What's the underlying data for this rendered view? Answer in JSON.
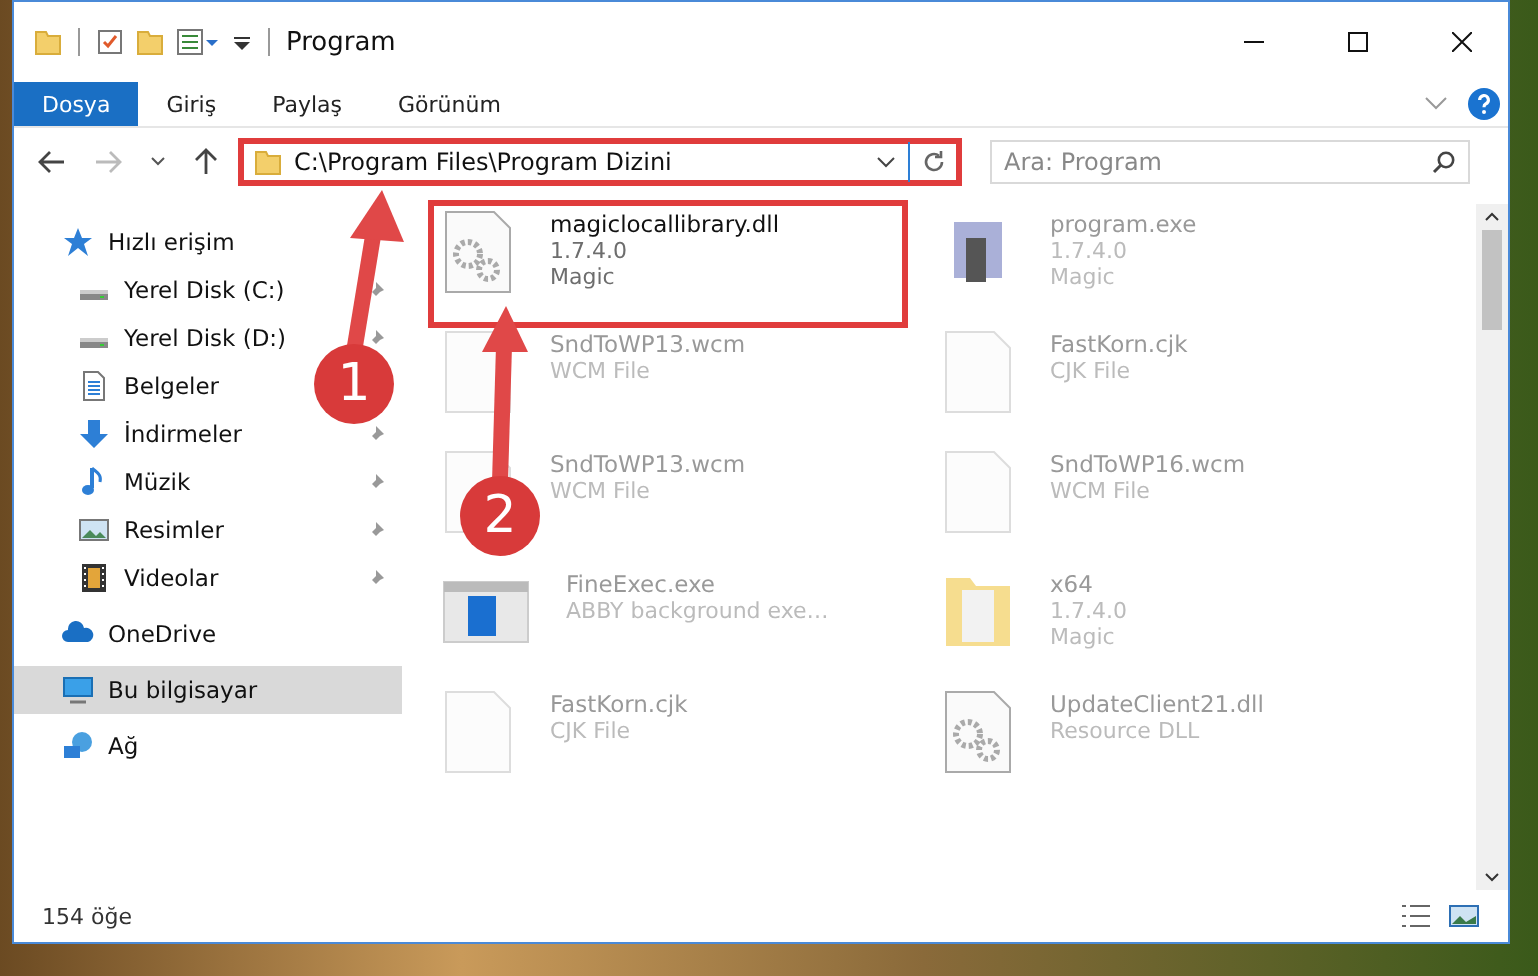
{
  "window": {
    "title": "Program"
  },
  "ribbon_tabs": [
    {
      "label": "Dosya",
      "selected": true
    },
    {
      "label": "Giriş",
      "selected": false
    },
    {
      "label": "Paylaş",
      "selected": false
    },
    {
      "label": "Görünüm",
      "selected": false
    }
  ],
  "address": {
    "path": "C:\\Program Files\\Program Dizini",
    "highlighted": true
  },
  "search": {
    "placeholder": "Ara: Program"
  },
  "sidebar": {
    "items": [
      {
        "label": "Hızlı erişim",
        "kind": "star",
        "pinned": false,
        "selected": false,
        "group": true
      },
      {
        "label": "Yerel Disk (C:)",
        "kind": "drive",
        "pinned": true,
        "selected": false,
        "group": false
      },
      {
        "label": "Yerel Disk (D:)",
        "kind": "drive",
        "pinned": true,
        "selected": false,
        "group": false
      },
      {
        "label": "Belgeler",
        "kind": "document",
        "pinned": false,
        "selected": false,
        "group": false
      },
      {
        "label": "İndirmeler",
        "kind": "download",
        "pinned": true,
        "selected": false,
        "group": false
      },
      {
        "label": "Müzik",
        "kind": "music",
        "pinned": true,
        "selected": false,
        "group": false
      },
      {
        "label": "Resimler",
        "kind": "picture",
        "pinned": true,
        "selected": false,
        "group": false
      },
      {
        "label": "Videolar",
        "kind": "video",
        "pinned": true,
        "selected": false,
        "group": false
      },
      {
        "label": "OneDrive",
        "kind": "cloud",
        "pinned": false,
        "selected": false,
        "group": true
      },
      {
        "label": "Bu bilgisayar",
        "kind": "computer",
        "pinned": false,
        "selected": true,
        "group": true
      },
      {
        "label": "Ağ",
        "kind": "network",
        "pinned": false,
        "selected": false,
        "group": true
      }
    ]
  },
  "files": [
    {
      "name": "magiclocallibrary.dll",
      "details": [
        "1.7.4.0",
        "Magic"
      ],
      "kind": "gears",
      "highlighted": true
    },
    {
      "name": "program.exe",
      "details": [
        "1.7.4.0",
        "Magic"
      ],
      "kind": "app",
      "highlighted": false
    },
    {
      "name": "SndToWP13.wcm",
      "details": [
        "WCM File"
      ],
      "kind": "blank",
      "highlighted": false
    },
    {
      "name": "FastKorn.cjk",
      "details": [
        "CJK File"
      ],
      "kind": "blank",
      "highlighted": false
    },
    {
      "name": "SndToWP13.wcm",
      "details": [
        "WCM File"
      ],
      "kind": "blank",
      "highlighted": false
    },
    {
      "name": "SndToWP16.wcm",
      "details": [
        "WCM File"
      ],
      "kind": "blank",
      "highlighted": false
    },
    {
      "name": "FineExec.exe",
      "details": [
        "ABBY background exe…"
      ],
      "kind": "window",
      "highlighted": false
    },
    {
      "name": "x64",
      "details": [
        "1.7.4.0",
        "Magic"
      ],
      "kind": "folder",
      "highlighted": false
    },
    {
      "name": "FastKorn.cjk",
      "details": [
        "CJK File"
      ],
      "kind": "blank",
      "highlighted": false
    },
    {
      "name": "UpdateClient21.dll",
      "details": [
        "Resource DLL"
      ],
      "kind": "gears",
      "highlighted": false
    }
  ],
  "annotations": [
    {
      "number": "1"
    },
    {
      "number": "2"
    }
  ],
  "status_bar": {
    "count": "154 öğe"
  }
}
